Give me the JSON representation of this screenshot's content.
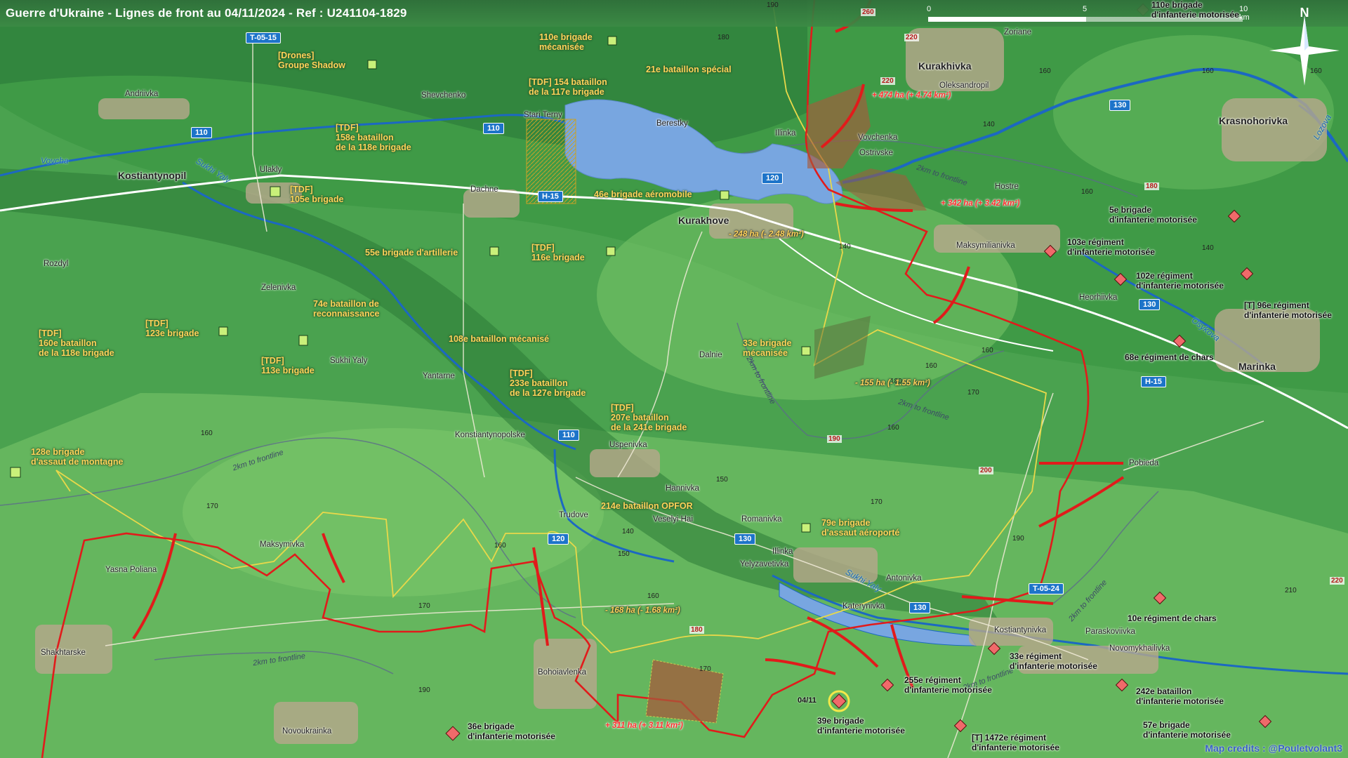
{
  "header": {
    "title": "Guerre d'Ukraine - Lignes de front au 04/11/2024 - Ref : U241104-1829"
  },
  "scale": {
    "t0": "0",
    "t5": "5",
    "t10": "10 km"
  },
  "compass": "N",
  "credits": "Map credits : @Pouletvolant3",
  "roads": [
    "T-05-15",
    "110",
    "110",
    "H-15",
    "110",
    "120",
    "130",
    "130",
    "H-15",
    "130",
    "T-05-24",
    "130",
    "120"
  ],
  "towns": [
    "Andriivka",
    "Shevchenko",
    "Stari Terny",
    "Berestky",
    "Illinka",
    "Kurakhivka",
    "Zoriane",
    "Oleksandropil",
    "Vovchenka",
    "Ostrivske",
    "Hostre",
    "Krasnohorivka",
    "Kostiantynopil",
    "Ulakly",
    "Dachne",
    "Kurakhove",
    "Maksymilianivka",
    "Rozdyl",
    "Zelenivka",
    "Heorhiivka",
    "Dalnie",
    "Marinka",
    "Sukhi Yaly",
    "Yantarne",
    "Konstiantynopolske",
    "Uspenivka",
    "Pobieda",
    "Hannivka",
    "Veselyi Hai",
    "Romanivka",
    "Trudove",
    "Maksymivka",
    "Illinka",
    "Yelyzavetivka",
    "Antonivka",
    "Yasna Poliana",
    "Katerynivka",
    "Kostiantynivka",
    "Paraskoviivka",
    "Novomykhailivka",
    "Shakhtarske",
    "Bohoiavlenka",
    "Novoukrainka"
  ],
  "rivers": [
    "Vovcha",
    "Sukhi Yaly",
    "Lozova",
    "Osykova",
    "Sukhi Yaly"
  ],
  "ukr_units": [
    "110e brigade\nmécanisée",
    "[Drones]\nGroupe Shadow",
    "21e bataillon spécial",
    "[TDF] 154 bataillon\nde la 117e brigade",
    "[TDF]\n158e bataillon\nde la 118e brigade",
    "[TDF]\n105e brigade",
    "46e brigade aéromobile",
    "55e brigade d'artillerie",
    "[TDF]\n116e brigade",
    "74e bataillon de\nreconnaissance",
    "[TDF]\n123e brigade",
    "[TDF]\n160e bataillon\nde la 118e brigade",
    "[TDF]\n113e brigade",
    "108e bataillon mécanisé",
    "33e brigade\nmécanisée",
    "[TDF]\n233e bataillon\nde la 127e brigade",
    "[TDF]\n207e bataillon\nde la 241e brigade",
    "128e brigade\nd'assaut de montagne",
    "214e bataillon OPFOR",
    "79e brigade\nd'assaut aéroporté"
  ],
  "rus_units": [
    "110e brigade\nd'infanterie motorisée",
    "5e brigade\nd'infanterie motorisée",
    "103e régiment\nd'infanterie motorisée",
    "102e régiment\nd'infanterie motorisée",
    "[T] 96e régiment\nd'infanterie motorisée",
    "68e régiment de chars",
    "10e régiment de chars",
    "33e régiment\nd'infanterie motorisée",
    "255e régiment\nd'infanterie motorisée",
    "242e bataillon\nd'infanterie motorisée",
    "39e brigade\nd'infanterie motorisée",
    "[T] 1472e régiment\nd'infanterie motorisée",
    "57e brigade\nd'infanterie motorisée",
    "36e brigade\nd'infanterie motorisée"
  ],
  "changes": [
    "+ 474 ha (+ 4.74 km²)",
    "+ 342 ha (+ 3.42 km²)",
    "- 248 ha (- 2.48 km²)",
    "- 155 ha (- 1.55 km²)",
    "- 168 ha (- 1.68 km²)",
    "+ 311 ha (+ 3.11 km²)"
  ],
  "date_marker": "04/11",
  "frontline_labels": [
    "2km to frontline",
    "2km to frontline",
    "2km to frontline",
    "2km to frontline",
    "2km to frontline",
    "2km to frontline",
    "2km to frontline"
  ],
  "elevations": [
    "190",
    "180",
    "260",
    "220",
    "220",
    "160",
    "140",
    "180",
    "160",
    "140",
    "160",
    "160",
    "160",
    "140",
    "160",
    "150",
    "170",
    "170",
    "160",
    "180",
    "190",
    "200",
    "190",
    "170",
    "150",
    "140",
    "160",
    "180",
    "170",
    "160",
    "190",
    "170",
    "210",
    "220",
    "160"
  ],
  "colors": {
    "frontline": "#e11b1b",
    "zone": "#e8d84a",
    "ukr_symbol": "#c9f07a",
    "rus_symbol": "#f06a6a",
    "lake": "#6fa0e0"
  }
}
